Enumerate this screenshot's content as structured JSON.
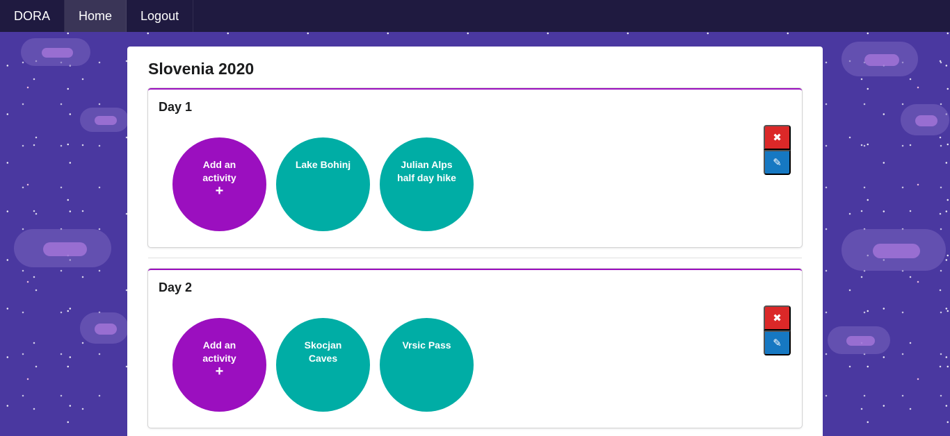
{
  "navbar": {
    "items": [
      {
        "label": "DORA",
        "active": false
      },
      {
        "label": "Home",
        "active": true
      },
      {
        "label": "Logout",
        "active": false
      }
    ]
  },
  "trip": {
    "title": "Slovenia 2020",
    "days": [
      {
        "title": "Day 1",
        "add_label_1": "Add an",
        "add_label_2": "activity",
        "add_icon": "+",
        "activities": [
          {
            "line1": "Lake Bohinj",
            "line2": ""
          },
          {
            "line1": "Julian Alps",
            "line2": "half day hike"
          }
        ]
      },
      {
        "title": "Day 2",
        "add_label_1": "Add an",
        "add_label_2": "activity",
        "add_icon": "+",
        "activities": [
          {
            "line1": "Skocjan",
            "line2": "Caves"
          },
          {
            "line1": "Vrsic Pass",
            "line2": ""
          }
        ]
      }
    ]
  },
  "icons": {
    "delete": "✖",
    "edit": "✎"
  },
  "colors": {
    "navbar": "#1f1a40",
    "add_circle": "#9b0fbf",
    "activity_circle": "#00ada5",
    "delete_button": "#db2828",
    "edit_button": "#1678c2",
    "card_accent": "#9b0fbf"
  }
}
